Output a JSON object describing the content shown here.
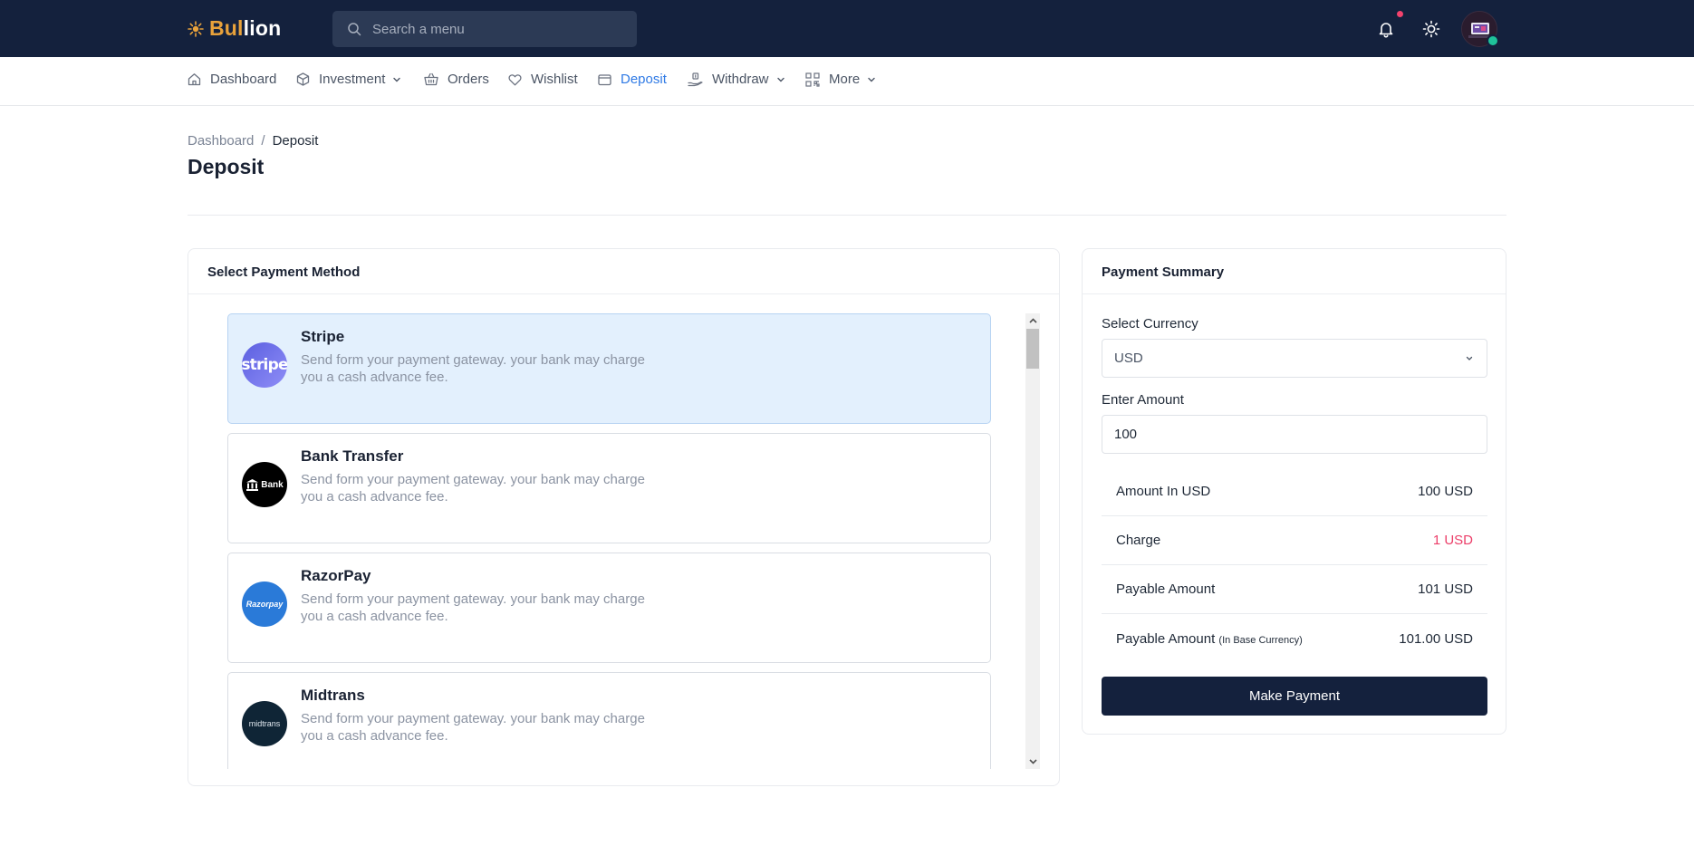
{
  "app": {
    "logo_part1": "Bul",
    "logo_part2": "lion"
  },
  "search": {
    "placeholder": "Search a menu"
  },
  "nav": {
    "items": [
      {
        "label": "Dashboard",
        "icon": "home-icon"
      },
      {
        "label": "Investment",
        "icon": "cube-icon",
        "dropdown": true
      },
      {
        "label": "Orders",
        "icon": "basket-icon"
      },
      {
        "label": "Wishlist",
        "icon": "heart-icon"
      },
      {
        "label": "Deposit",
        "icon": "wallet-icon",
        "active": true
      },
      {
        "label": "Withdraw",
        "icon": "withdraw-icon",
        "dropdown": true
      },
      {
        "label": "More",
        "icon": "grid-icon",
        "dropdown": true
      }
    ]
  },
  "breadcrumb": {
    "parent": "Dashboard",
    "separator": "/",
    "current": "Deposit"
  },
  "page": {
    "title": "Deposit"
  },
  "methods_card": {
    "title": "Select Payment Method",
    "methods": [
      {
        "name": "Stripe",
        "logo_text": "stripe",
        "description": "Send form your payment gateway. your bank may charge you a cash advance fee.",
        "selected": true,
        "logo_color": "#6c6ee8"
      },
      {
        "name": "Bank Transfer",
        "logo_text": "Bank",
        "description": "Send form your payment gateway. your bank may charge you a cash advance fee.",
        "selected": false,
        "logo_color": "#000000"
      },
      {
        "name": "RazorPay",
        "logo_text": "Razorpay",
        "description": "Send form your payment gateway. your bank may charge you a cash advance fee.",
        "selected": false,
        "logo_color": "#2a7ad8"
      },
      {
        "name": "Midtrans",
        "logo_text": "midtrans",
        "description": "Send form your payment gateway. your bank may charge you a cash advance fee.",
        "selected": false,
        "logo_color": "#0f2536"
      }
    ]
  },
  "summary": {
    "title": "Payment Summary",
    "currency_label": "Select Currency",
    "currency_value": "USD",
    "amount_label": "Enter Amount",
    "amount_value": "100",
    "rows": [
      {
        "label": "Amount In USD",
        "value": "100 USD"
      },
      {
        "label": "Charge",
        "value": "1 USD"
      },
      {
        "label": "Payable Amount",
        "value": "101 USD"
      },
      {
        "label": "Payable Amount",
        "sublabel": "(In Base Currency)",
        "value": "101.00 USD"
      }
    ],
    "button": "Make Payment"
  },
  "colors": {
    "topbar": "#14213d",
    "accent": "#2f7ae5",
    "logo_gold": "#e9a23b",
    "charge": "#ec3e69",
    "notification": "#f3426d",
    "online": "#1fc29a"
  }
}
